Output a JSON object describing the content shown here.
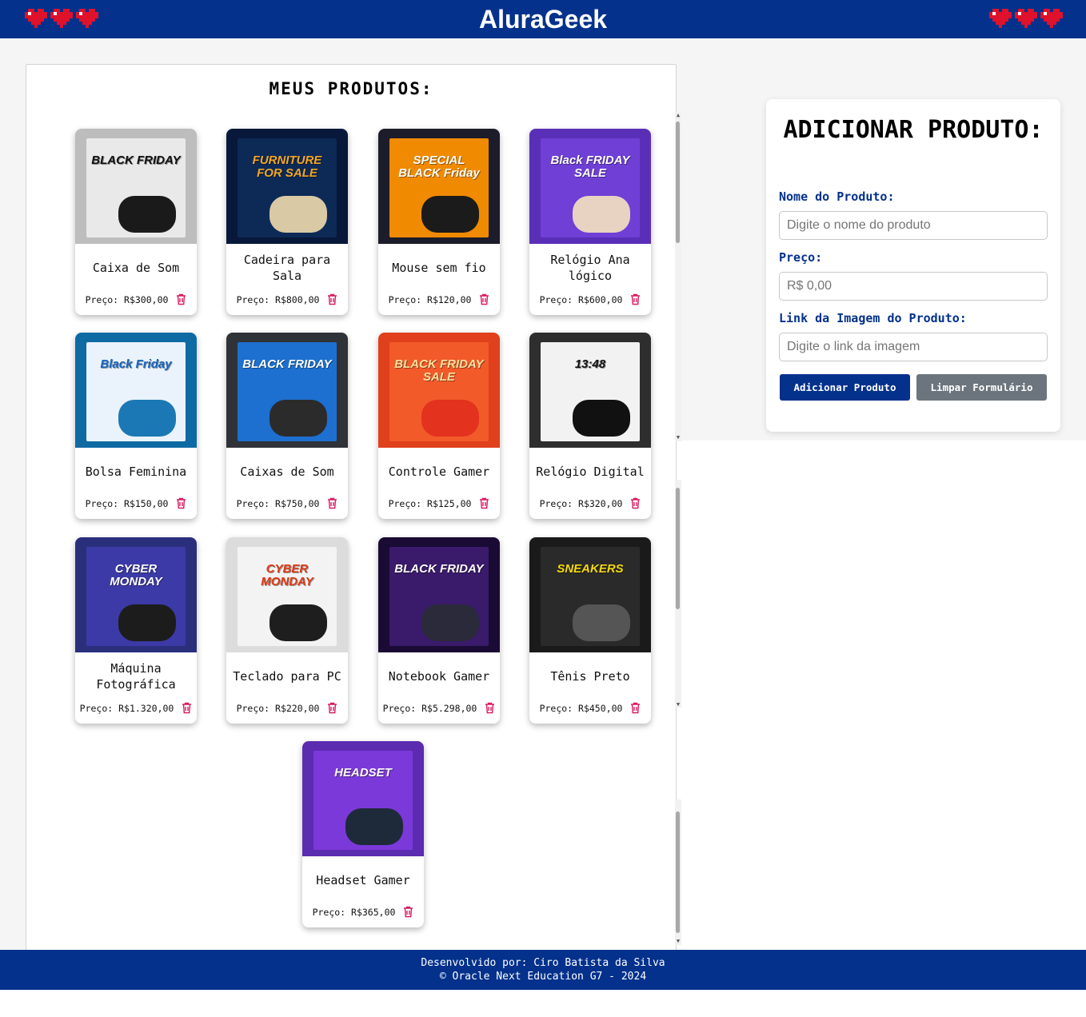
{
  "header": {
    "title": "AluraGeek",
    "heart_color": "#e0112b",
    "background": "#03318c"
  },
  "products_panel": {
    "title": "MEUS PRODUTOS:",
    "items": [
      {
        "name": "Caixa de Som",
        "price": "Preço: R$300,00",
        "poster": {
          "bg": "#e9e9e9",
          "frame": "#bdbdbd",
          "title": "BLACK FRIDAY",
          "title_color": "#111111",
          "object": "#1a1a1a"
        }
      },
      {
        "name": "Cadeira para Sala",
        "price": "Preço: R$800,00",
        "poster": {
          "bg": "#0d2a56",
          "frame": "#07183a",
          "title": "FURNITURE FOR SALE",
          "title_color": "#f5a623",
          "object": "#d9c9a5"
        }
      },
      {
        "name": "Mouse sem fio",
        "price": "Preço: R$120,00",
        "poster": {
          "bg": "#f08a00",
          "frame": "#1c1c2a",
          "title": "SPECIAL BLACK Friday",
          "title_color": "#ffffff",
          "object": "#1b1b1b"
        }
      },
      {
        "name": "Relógio Ana lógico",
        "price": "Preço: R$600,00",
        "poster": {
          "bg": "#6f3fd6",
          "frame": "#5a2fb8",
          "title": "Black FRIDAY SALE",
          "title_color": "#ffffff",
          "object": "#e8d3c3"
        }
      },
      {
        "name": "Bolsa Feminina",
        "price": "Preço: R$150,00",
        "poster": {
          "bg": "#eaf3fb",
          "frame": "#0e6aa3",
          "title": "Black Friday",
          "title_color": "#1565c0",
          "object": "#1b78b5"
        }
      },
      {
        "name": "Caixas de Som",
        "price": "Preço: R$750,00",
        "poster": {
          "bg": "#1d6fd0",
          "frame": "#2f3236",
          "title": "BLACK FRIDAY",
          "title_color": "#ffffff",
          "object": "#2b2b2b"
        }
      },
      {
        "name": "Controle Gamer",
        "price": "Preço: R$125,00",
        "poster": {
          "bg": "#f25a2a",
          "frame": "#e0401c",
          "title": "BLACK FRIDAY SALE",
          "title_color": "#ffe3a0",
          "object": "#e3321e"
        }
      },
      {
        "name": "Relógio Digital",
        "price": "Preço: R$320,00",
        "poster": {
          "bg": "#f2f2f2",
          "frame": "#2e2e2e",
          "title": "13:48",
          "title_color": "#111111",
          "object": "#111111"
        }
      },
      {
        "name": "Máquina Fotográfica",
        "price": "Preço: R$1.320,00",
        "poster": {
          "bg": "#3c3aa6",
          "frame": "#2a2f7c",
          "title": "CYBER MONDAY",
          "title_color": "#ffffff",
          "object": "#1c1c1c"
        }
      },
      {
        "name": "Teclado para PC",
        "price": "Preço: R$220,00",
        "poster": {
          "bg": "#f3f3f3",
          "frame": "#dcdcdc",
          "title": "CYBER MONDAY",
          "title_color": "#e03a16",
          "object": "#1e1e1e"
        }
      },
      {
        "name": "Notebook Gamer",
        "price": "Preço: R$5.298,00",
        "poster": {
          "bg": "#3a1a6a",
          "frame": "#1a0b35",
          "title": "BLACK FRIDAY",
          "title_color": "#ffffff",
          "object": "#2a2a3a"
        }
      },
      {
        "name": "Tênis Preto",
        "price": "Preço: R$450,00",
        "poster": {
          "bg": "#2a2a2a",
          "frame": "#1a1a1a",
          "title": "SNEAKERS",
          "title_color": "#f5d90a",
          "object": "#555555"
        }
      },
      {
        "name": "Headset Gamer",
        "price": "Preço: R$365,00",
        "poster": {
          "bg": "#7b39d9",
          "frame": "#5b2bb0",
          "title": "HEADSET",
          "title_color": "#ffffff",
          "object": "#1e2a3a"
        }
      }
    ]
  },
  "form": {
    "title": "ADICIONAR PRODUTO:",
    "name_label": "Nome do Produto:",
    "name_placeholder": "Digite o nome do produto",
    "price_label": "Preço:",
    "price_placeholder": "R$ 0,00",
    "image_label": "Link da Imagem do Produto:",
    "image_placeholder": "Digite o link da imagem",
    "submit_label": "Adicionar Produto",
    "clear_label": "Limpar Formulário"
  },
  "footer": {
    "line1": "Desenvolvido por: Ciro Batista da Silva",
    "line2": "© Oracle Next Education G7 - 2024"
  },
  "colors": {
    "brand": "#03318c",
    "trash": "#d81b60",
    "secondary_button": "#6c757d"
  }
}
